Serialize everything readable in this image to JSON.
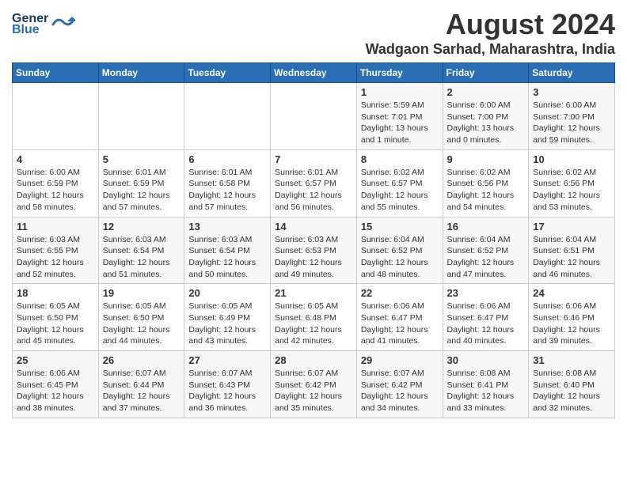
{
  "logo": {
    "line1": "General",
    "line2": "Blue"
  },
  "title": "August 2024",
  "subtitle": "Wadgaon Sarhad, Maharashtra, India",
  "days_of_week": [
    "Sunday",
    "Monday",
    "Tuesday",
    "Wednesday",
    "Thursday",
    "Friday",
    "Saturday"
  ],
  "weeks": [
    [
      {
        "num": "",
        "info": ""
      },
      {
        "num": "",
        "info": ""
      },
      {
        "num": "",
        "info": ""
      },
      {
        "num": "",
        "info": ""
      },
      {
        "num": "1",
        "info": "Sunrise: 5:59 AM\nSunset: 7:01 PM\nDaylight: 13 hours\nand 1 minute."
      },
      {
        "num": "2",
        "info": "Sunrise: 6:00 AM\nSunset: 7:00 PM\nDaylight: 13 hours\nand 0 minutes."
      },
      {
        "num": "3",
        "info": "Sunrise: 6:00 AM\nSunset: 7:00 PM\nDaylight: 12 hours\nand 59 minutes."
      }
    ],
    [
      {
        "num": "4",
        "info": "Sunrise: 6:00 AM\nSunset: 6:59 PM\nDaylight: 12 hours\nand 58 minutes."
      },
      {
        "num": "5",
        "info": "Sunrise: 6:01 AM\nSunset: 6:59 PM\nDaylight: 12 hours\nand 57 minutes."
      },
      {
        "num": "6",
        "info": "Sunrise: 6:01 AM\nSunset: 6:58 PM\nDaylight: 12 hours\nand 57 minutes."
      },
      {
        "num": "7",
        "info": "Sunrise: 6:01 AM\nSunset: 6:57 PM\nDaylight: 12 hours\nand 56 minutes."
      },
      {
        "num": "8",
        "info": "Sunrise: 6:02 AM\nSunset: 6:57 PM\nDaylight: 12 hours\nand 55 minutes."
      },
      {
        "num": "9",
        "info": "Sunrise: 6:02 AM\nSunset: 6:56 PM\nDaylight: 12 hours\nand 54 minutes."
      },
      {
        "num": "10",
        "info": "Sunrise: 6:02 AM\nSunset: 6:56 PM\nDaylight: 12 hours\nand 53 minutes."
      }
    ],
    [
      {
        "num": "11",
        "info": "Sunrise: 6:03 AM\nSunset: 6:55 PM\nDaylight: 12 hours\nand 52 minutes."
      },
      {
        "num": "12",
        "info": "Sunrise: 6:03 AM\nSunset: 6:54 PM\nDaylight: 12 hours\nand 51 minutes."
      },
      {
        "num": "13",
        "info": "Sunrise: 6:03 AM\nSunset: 6:54 PM\nDaylight: 12 hours\nand 50 minutes."
      },
      {
        "num": "14",
        "info": "Sunrise: 6:03 AM\nSunset: 6:53 PM\nDaylight: 12 hours\nand 49 minutes."
      },
      {
        "num": "15",
        "info": "Sunrise: 6:04 AM\nSunset: 6:52 PM\nDaylight: 12 hours\nand 48 minutes."
      },
      {
        "num": "16",
        "info": "Sunrise: 6:04 AM\nSunset: 6:52 PM\nDaylight: 12 hours\nand 47 minutes."
      },
      {
        "num": "17",
        "info": "Sunrise: 6:04 AM\nSunset: 6:51 PM\nDaylight: 12 hours\nand 46 minutes."
      }
    ],
    [
      {
        "num": "18",
        "info": "Sunrise: 6:05 AM\nSunset: 6:50 PM\nDaylight: 12 hours\nand 45 minutes."
      },
      {
        "num": "19",
        "info": "Sunrise: 6:05 AM\nSunset: 6:50 PM\nDaylight: 12 hours\nand 44 minutes."
      },
      {
        "num": "20",
        "info": "Sunrise: 6:05 AM\nSunset: 6:49 PM\nDaylight: 12 hours\nand 43 minutes."
      },
      {
        "num": "21",
        "info": "Sunrise: 6:05 AM\nSunset: 6:48 PM\nDaylight: 12 hours\nand 42 minutes."
      },
      {
        "num": "22",
        "info": "Sunrise: 6:06 AM\nSunset: 6:47 PM\nDaylight: 12 hours\nand 41 minutes."
      },
      {
        "num": "23",
        "info": "Sunrise: 6:06 AM\nSunset: 6:47 PM\nDaylight: 12 hours\nand 40 minutes."
      },
      {
        "num": "24",
        "info": "Sunrise: 6:06 AM\nSunset: 6:46 PM\nDaylight: 12 hours\nand 39 minutes."
      }
    ],
    [
      {
        "num": "25",
        "info": "Sunrise: 6:06 AM\nSunset: 6:45 PM\nDaylight: 12 hours\nand 38 minutes."
      },
      {
        "num": "26",
        "info": "Sunrise: 6:07 AM\nSunset: 6:44 PM\nDaylight: 12 hours\nand 37 minutes."
      },
      {
        "num": "27",
        "info": "Sunrise: 6:07 AM\nSunset: 6:43 PM\nDaylight: 12 hours\nand 36 minutes."
      },
      {
        "num": "28",
        "info": "Sunrise: 6:07 AM\nSunset: 6:42 PM\nDaylight: 12 hours\nand 35 minutes."
      },
      {
        "num": "29",
        "info": "Sunrise: 6:07 AM\nSunset: 6:42 PM\nDaylight: 12 hours\nand 34 minutes."
      },
      {
        "num": "30",
        "info": "Sunrise: 6:08 AM\nSunset: 6:41 PM\nDaylight: 12 hours\nand 33 minutes."
      },
      {
        "num": "31",
        "info": "Sunrise: 6:08 AM\nSunset: 6:40 PM\nDaylight: 12 hours\nand 32 minutes."
      }
    ]
  ]
}
